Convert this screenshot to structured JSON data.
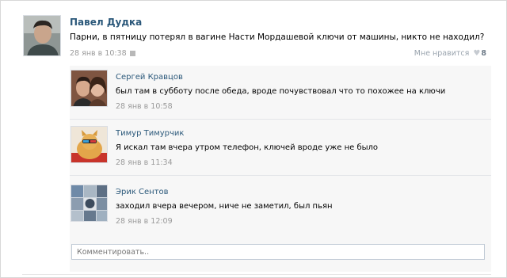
{
  "post": {
    "author": "Павел Дудка",
    "text": "Парни, в пятницу потерял в вагине Насти Мордашевой ключи от машины, никто не находил?",
    "time": "28 янв в 10:38",
    "like_label": "Мне нравится",
    "like_count": "8"
  },
  "comments": [
    {
      "author": "Сергей Кравцов",
      "text": "был там в субботу после обеда, вроде почувствовал что то похожее на ключи",
      "time": "28 янв в 10:58"
    },
    {
      "author": "Тимур Тимурчик",
      "text": "Я искал там вчера утром телефон, ключей вроде уже не было",
      "time": "28 янв в 11:34"
    },
    {
      "author": "Эрик Сентов",
      "text": "заходил вчера вечером, ниче не заметил, был пьян",
      "time": "28 янв в 12:09"
    }
  ],
  "comment_input": {
    "placeholder": "Комментировать.."
  },
  "colors": {
    "link": "#2b587a",
    "meta": "#9a9a9a",
    "comments_bg": "#f7f7f7"
  }
}
